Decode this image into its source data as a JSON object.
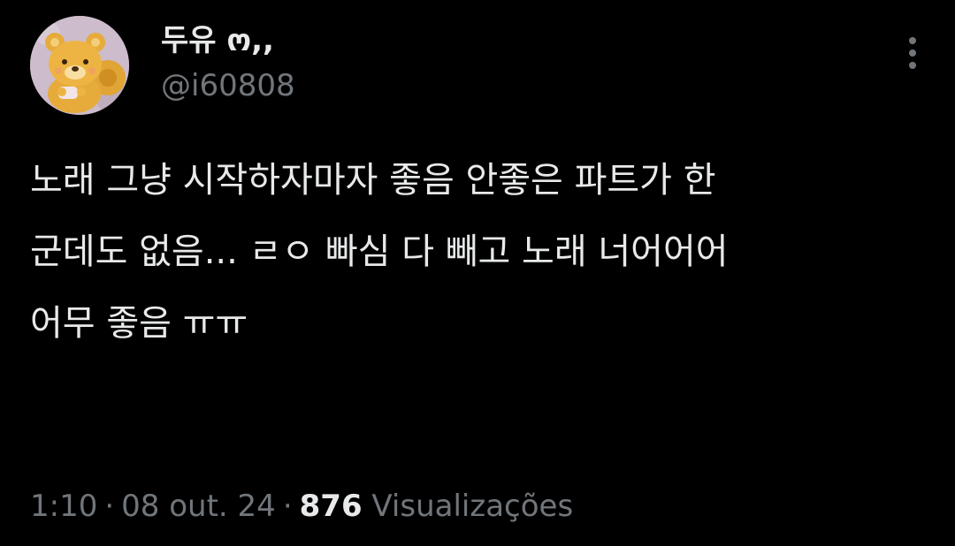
{
  "author": {
    "display_name": "두유 ო,,",
    "handle": "@i60808",
    "avatar_icon": "teddy-bear-avatar-icon"
  },
  "tweet": {
    "lines": [
      "노래 그냥 시작하자마자 좋음 안좋은 파트가 한",
      "군데도 없음... ㄹㅇ 빠심 다 빼고 노래 너어어어",
      "어무 좋음 ㅠㅠ"
    ]
  },
  "meta": {
    "time": "1:10",
    "separator": "·",
    "date": "08 out. 24",
    "views_count": "876",
    "views_label": "Visualizações"
  },
  "colors": {
    "background": "#000000",
    "primary_text": "#e7e9ea",
    "secondary_text": "#71767b"
  }
}
